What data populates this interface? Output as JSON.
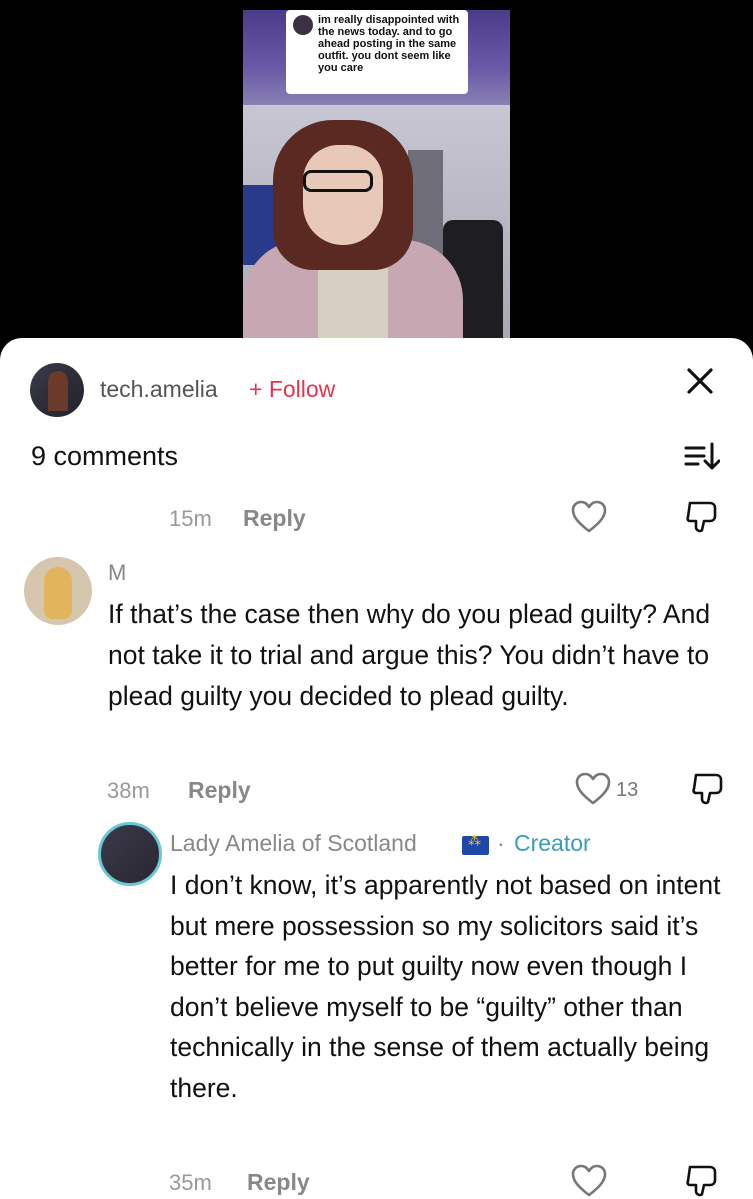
{
  "video": {
    "question_bubble": "im really disappointed with the news today. and to go ahead posting in the same outfit. you dont seem like you care"
  },
  "header": {
    "username": "tech.amelia",
    "follow_label": "+ Follow",
    "close_icon": "close-icon"
  },
  "comments_count": "9 comments",
  "sort_icon": "sort-icon",
  "top_reply_row": {
    "time": "15m",
    "reply_label": "Reply"
  },
  "comment": {
    "author": "M",
    "text": "If that’s the case then why do you plead guilty? And not take it to trial and argue this? You didn’t have to plead guilty you decided to plead guilty.",
    "time": "38m",
    "reply_label": "Reply",
    "likes": "13"
  },
  "reply": {
    "author": "Lady Amelia of Scotland",
    "separator": "·",
    "badge": "Creator",
    "text": "I don’t know, it’s apparently not based on intent but mere possession so my solicitors said it’s better for me to put guilty now even though I don’t believe myself to be “guilty” other than technically in the sense of them actually being there.",
    "time": "35m",
    "reply_label": "Reply"
  },
  "colors": {
    "follow": "#e8334f",
    "creator": "#3a9bbf",
    "muted": "#999999"
  }
}
